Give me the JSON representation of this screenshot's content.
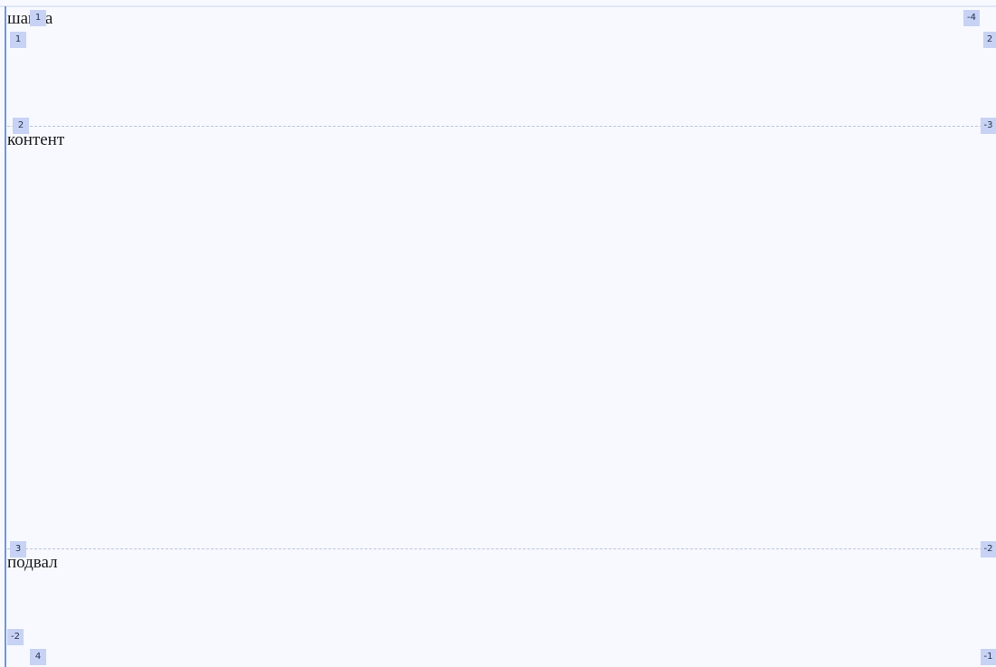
{
  "areas": {
    "header": "шапка",
    "content": "контент",
    "footer": "подвал"
  },
  "row_lines": {
    "start": [
      "1",
      "2",
      "3",
      "4"
    ],
    "end": [
      "-4",
      "-3",
      "-2",
      "-1"
    ]
  },
  "column_lines": {
    "start": "1",
    "end": "2",
    "start_neg": "-2",
    "end_neg": "-1"
  }
}
